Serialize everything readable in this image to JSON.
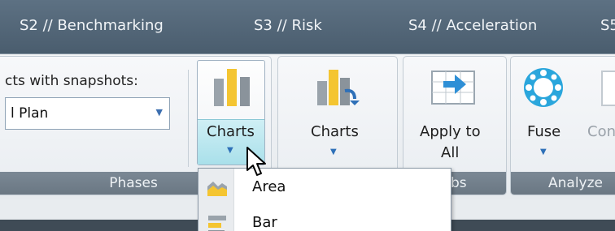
{
  "tabs": [
    {
      "label": "S2 // Benchmarking"
    },
    {
      "label": "S3 // Risk"
    },
    {
      "label": "S4 // Acceleration"
    },
    {
      "label": "S5"
    }
  ],
  "phases": {
    "snapshots_label": "cts with snapshots:",
    "combo_value": "l  Plan",
    "footer": "Phases"
  },
  "charts_button": {
    "label": "Charts"
  },
  "charts_button_2": {
    "label": "Charts"
  },
  "apply_button": {
    "label_line1": "Apply to",
    "label_line2": "All"
  },
  "tabs_group": {
    "footer": "bs"
  },
  "analyze_group": {
    "fuse_label": "Fuse",
    "con_label": "Con",
    "footer": "Analyze"
  },
  "menu": {
    "items": [
      {
        "label": "Area",
        "icon": "area-chart-icon"
      },
      {
        "label": "Bar",
        "icon": "bar-chart-icon"
      }
    ]
  },
  "colors": {
    "tabbar": "#4a5d6e",
    "footer": "#6f7c88",
    "accent_yellow": "#f4c531",
    "accent_blue": "#2e70b8",
    "charts_highlight": "#a9e0ea"
  }
}
